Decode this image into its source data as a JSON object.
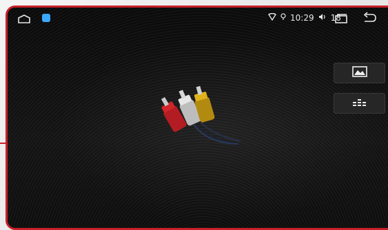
{
  "statusbar": {
    "time": "10:29",
    "volume": "18",
    "icons": [
      "home-icon",
      "app-icon",
      "wifi-icon",
      "location-icon",
      "volume-icon",
      "recent-apps-icon",
      "back-icon"
    ]
  },
  "side_buttons": [
    "picture-icon",
    "equalizer-icon"
  ],
  "center_image": "rca-cables-icon",
  "colors": {
    "frame": "#c8202a",
    "cable_red": "#d0252b",
    "cable_white": "#e6e6e6",
    "cable_yellow": "#e0b21a"
  }
}
